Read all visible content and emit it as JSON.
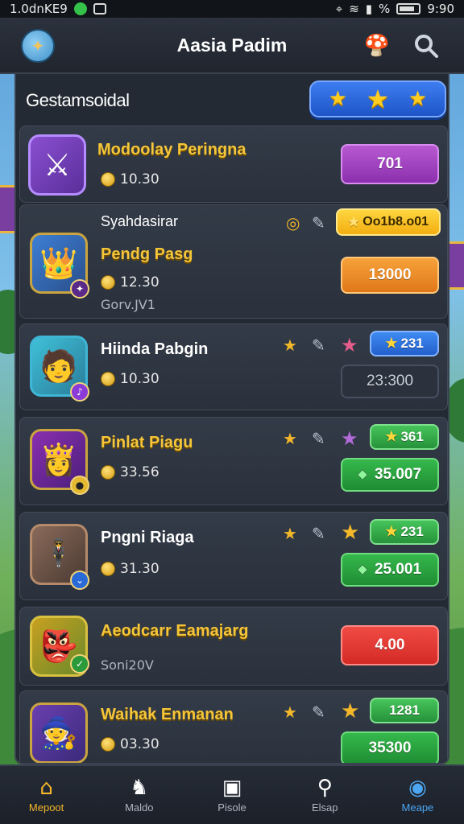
{
  "status_bar": {
    "left_text": "1.0dnKE9",
    "right_text": "% ",
    "time": "9:90"
  },
  "header": {
    "title": "Aasia Padim",
    "avatar_icon": "shield-emblem-icon",
    "mascot_icon": "mushroom-mascot-icon",
    "search_icon": "search-icon"
  },
  "panel": {
    "title": "Gestamsoidal",
    "stars_button_stars": [
      "★",
      "★",
      "★"
    ]
  },
  "rows": [
    {
      "name": "Modoolay Peringna",
      "coins": "10.30",
      "button": "701",
      "button_color": "#9a3dbf"
    },
    {
      "header_label": "Syahdasirar",
      "badge": "Oo1b8.o01",
      "name": "Pendg Pasg",
      "coins": "12.30",
      "sub": "Gorv.JV1",
      "button": "13000",
      "button_color": "#ec8a24"
    },
    {
      "name": "Hiinda Pabgin",
      "small_pill": "231",
      "coins": "10.30",
      "button": "23:300",
      "button_color": "#2b323d"
    },
    {
      "name": "Pinlat Piagu",
      "small_pill": "361",
      "coins": "33.56",
      "button": "35.007",
      "button_color": "#27a23e"
    },
    {
      "name": "Pngni Riaga",
      "small_pill": "231",
      "coins": "31.30",
      "button": "25.001",
      "button_color": "#27a23e"
    },
    {
      "name": "Aeodcarr Eamajarg",
      "sub": "Soni20V",
      "button": "4.00",
      "button_color": "#e23a35"
    },
    {
      "name": "Waihak Enmanan",
      "small_pill": "1281",
      "coins": "03.30",
      "button": "35300",
      "button_color": "#27a23e"
    }
  ],
  "tabs": [
    {
      "label": "Mepoot",
      "icon": "home-icon"
    },
    {
      "label": "Maldo",
      "icon": "shop-icon"
    },
    {
      "label": "Pisole",
      "icon": "box-icon"
    },
    {
      "label": "Elsap",
      "icon": "search-icon"
    },
    {
      "label": "Meape",
      "icon": "map-icon"
    }
  ],
  "colors": {
    "accent_blue": "#2f6fe0",
    "gold": "#f5c63a",
    "panel_bg": "#242a33"
  }
}
